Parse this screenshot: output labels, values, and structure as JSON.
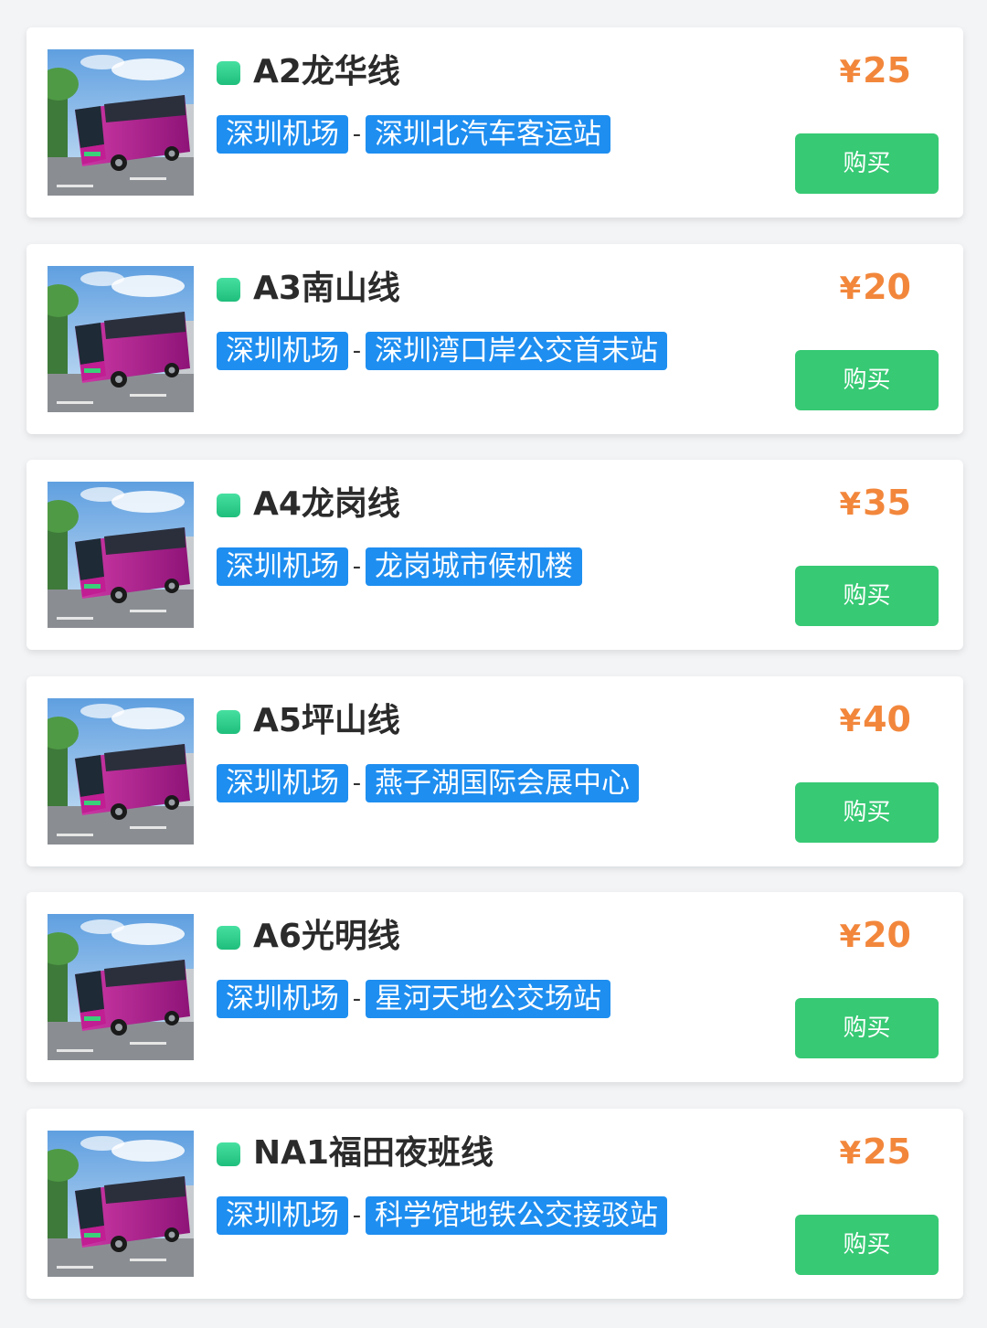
{
  "colors": {
    "accent_green": "#37c974",
    "tag_blue": "#1e8ef0",
    "price_orange": "#f2873c",
    "bus_magenta": "#b0208c"
  },
  "currency_symbol": "¥",
  "stop_separator": "-",
  "thumbnail_icon": "airport-bus-photo",
  "routes": [
    {
      "name": "A2龙华线",
      "origin": "深圳机场",
      "destination": "深圳北汽车客运站",
      "price": "25",
      "buy_label": "购买"
    },
    {
      "name": "A3南山线",
      "origin": "深圳机场",
      "destination": "深圳湾口岸公交首末站",
      "price": "20",
      "buy_label": "购买"
    },
    {
      "name": "A4龙岗线",
      "origin": "深圳机场",
      "destination": "龙岗城市候机楼",
      "price": "35",
      "buy_label": "购买"
    },
    {
      "name": "A5坪山线",
      "origin": "深圳机场",
      "destination": "燕子湖国际会展中心",
      "price": "40",
      "buy_label": "购买"
    },
    {
      "name": "A6光明线",
      "origin": "深圳机场",
      "destination": "星河天地公交场站",
      "price": "20",
      "buy_label": "购买"
    },
    {
      "name": "NA1福田夜班线",
      "origin": "深圳机场",
      "destination": "科学馆地铁公交接驳站",
      "price": "25",
      "buy_label": "购买"
    }
  ]
}
